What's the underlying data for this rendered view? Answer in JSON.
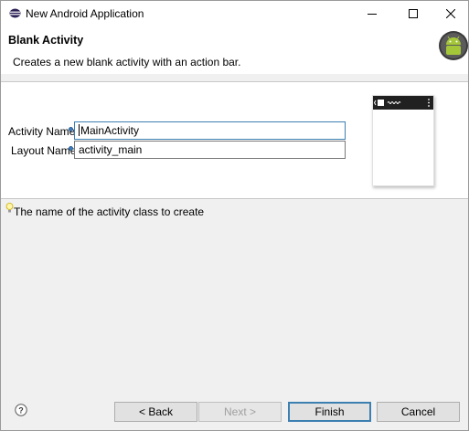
{
  "window": {
    "title": "New Android Application",
    "controls": [
      "minimize-icon",
      "maximize-icon",
      "close-icon"
    ]
  },
  "header": {
    "title": "Blank Activity",
    "description": "Creates a new blank activity with an action bar."
  },
  "form": {
    "activity_name": {
      "label": "Activity Name",
      "value": "MainActivity"
    },
    "layout_name": {
      "label": "Layout Name",
      "value": "activity_main"
    }
  },
  "help": {
    "text": "The name of the activity class to create"
  },
  "buttons": {
    "back": "< Back",
    "next": "Next >",
    "finish": "Finish",
    "cancel": "Cancel"
  },
  "colors": {
    "accent": "#3c7fb1",
    "android_green": "#a4c639",
    "info": "#3b7fc4"
  }
}
